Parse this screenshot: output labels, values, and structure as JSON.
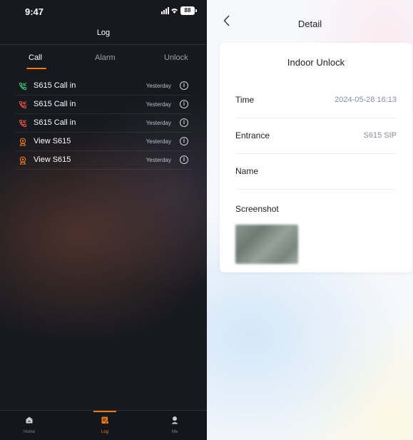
{
  "left": {
    "status": {
      "time": "9:47",
      "signal": "ⵗⵗ! ◠",
      "battery": "88"
    },
    "title": "Log",
    "tabs": [
      {
        "label": "Call",
        "active": true
      },
      {
        "label": "Alarm",
        "active": false
      },
      {
        "label": "Unlock",
        "active": false
      }
    ],
    "rows": [
      {
        "icon": "phone-call-in-green-icon",
        "label": "S615 Call in",
        "time": "Yesterday"
      },
      {
        "icon": "phone-call-in-red-icon",
        "label": "S615 Call in",
        "time": "Yesterday"
      },
      {
        "icon": "phone-call-in-red-icon",
        "label": "S615 Call in",
        "time": "Yesterday"
      },
      {
        "icon": "camera-view-icon",
        "label": "View S615",
        "time": "Yesterday"
      },
      {
        "icon": "camera-view-icon",
        "label": "View S615",
        "time": "Yesterday"
      }
    ],
    "nav": [
      {
        "label": "Home",
        "icon": "home-icon",
        "active": false
      },
      {
        "label": "Log",
        "icon": "log-icon",
        "active": true
      },
      {
        "label": "Me",
        "icon": "person-icon",
        "active": false
      }
    ],
    "colors": {
      "accent": "#f07a1a",
      "green": "#3ec86a",
      "red": "#e8524a"
    }
  },
  "right": {
    "title": "Detail",
    "card": {
      "title": "Indoor Unlock",
      "fields": [
        {
          "label": "Time",
          "value": "2024-05-28 16:13"
        },
        {
          "label": "Entrance",
          "value": "S615 SIP"
        },
        {
          "label": "Name",
          "value": ""
        }
      ],
      "screenshot_label": "Screenshot"
    }
  }
}
